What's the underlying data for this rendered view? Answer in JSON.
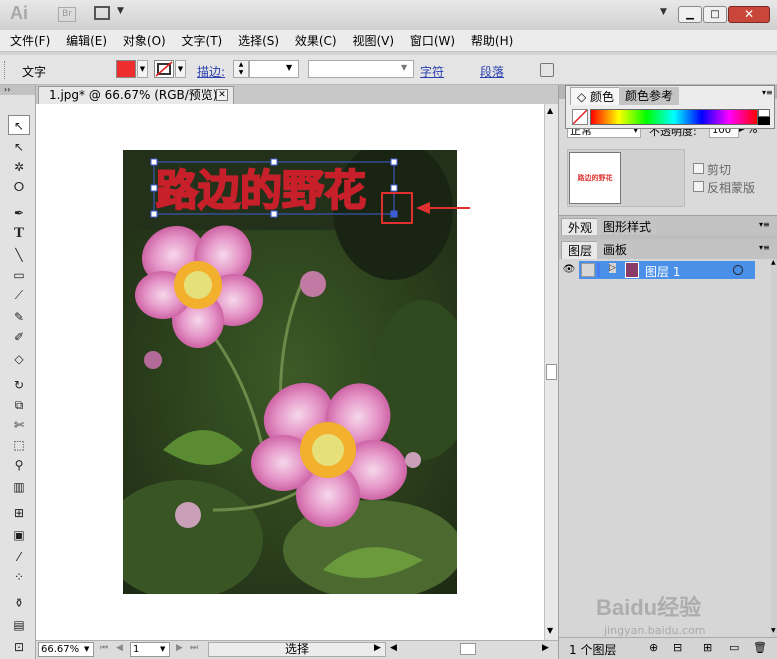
{
  "app": {
    "logo": "Ai",
    "bridge": "Br"
  },
  "menu": [
    "文件(F)",
    "编辑(E)",
    "对象(O)",
    "文字(T)",
    "选择(S)",
    "效果(C)",
    "视图(V)",
    "窗口(W)",
    "帮助(H)"
  ],
  "control": {
    "mode_label": "文字",
    "stroke_label": "描边:",
    "char_label": "字符",
    "para_label": "段落",
    "fill_color": "#ee2e2e"
  },
  "document": {
    "tab_title": "1.jpg* @ 66.67% (RGB/预览)",
    "text_on_image": "路边的野花"
  },
  "status": {
    "zoom": "66.67%",
    "page": "1",
    "tool": "选择"
  },
  "color_panel": {
    "tab_color": "颜色",
    "tab_guide": "颜色参考"
  },
  "transparency": {
    "blend_mode": "正常",
    "opacity_label": "不透明度:",
    "opacity_value": "100",
    "opacity_unit": "%",
    "clip_label": "剪切",
    "invert_label": "反相蒙版",
    "thumb_text": "路边的野花"
  },
  "appearance": {
    "tab_appearance": "外观",
    "tab_graphic_styles": "图形样式"
  },
  "layers": {
    "tab_layers": "图层",
    "tab_artboards": "画板",
    "layer_name": "图层 1",
    "count_label": "1 个图层"
  },
  "watermark": {
    "brand": "Baidu经验",
    "url": "jingyan.baidu.com"
  }
}
